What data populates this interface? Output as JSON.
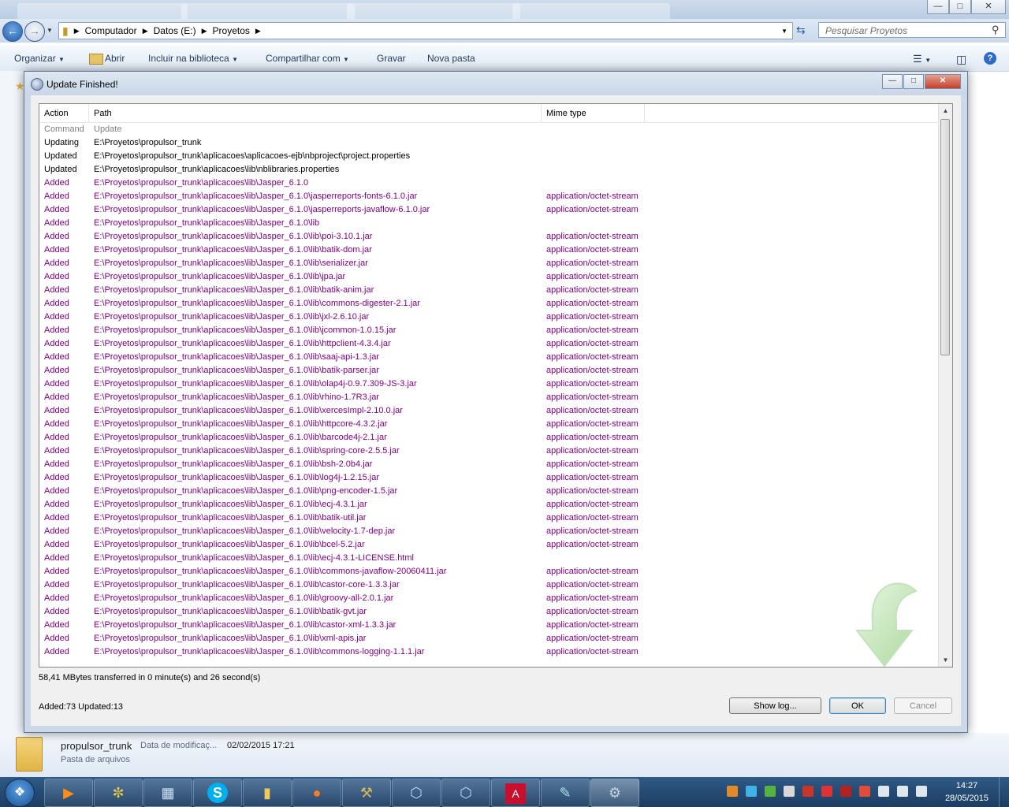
{
  "explorer": {
    "address": [
      "Computador",
      "Datos (E:)",
      "Proyetos"
    ],
    "search_placeholder": "Pesquisar Proyetos",
    "toolbar": {
      "organize": "Organizar",
      "open": "Abrir",
      "include_library": "Incluir na biblioteca",
      "share": "Compartilhar com",
      "burn": "Gravar",
      "new_folder": "Nova pasta"
    },
    "details": {
      "name": "propulsor_trunk",
      "modified_label": "Data de modificaç...",
      "modified_value": "02/02/2015 17:21",
      "type": "Pasta de arquivos"
    }
  },
  "dialog": {
    "title": "Update Finished!",
    "columns": {
      "action": "Action",
      "path": "Path",
      "mime": "Mime type"
    },
    "rows": [
      {
        "action": "Command",
        "path": "Update",
        "mime": "",
        "style": "muted"
      },
      {
        "action": "Updating",
        "path": "E:\\Proyetos\\propulsor_trunk",
        "mime": "",
        "style": "normal"
      },
      {
        "action": "Updated",
        "path": "E:\\Proyetos\\propulsor_trunk\\aplicacoes\\aplicacoes-ejb\\nbproject\\project.properties",
        "mime": "",
        "style": "normal"
      },
      {
        "action": "Updated",
        "path": "E:\\Proyetos\\propulsor_trunk\\aplicacoes\\lib\\nblibraries.properties",
        "mime": "",
        "style": "normal"
      },
      {
        "action": "Added",
        "path": "E:\\Proyetos\\propulsor_trunk\\aplicacoes\\lib\\Jasper_6.1.0",
        "mime": "",
        "style": "added"
      },
      {
        "action": "Added",
        "path": "E:\\Proyetos\\propulsor_trunk\\aplicacoes\\lib\\Jasper_6.1.0\\jasperreports-fonts-6.1.0.jar",
        "mime": "application/octet-stream",
        "style": "added"
      },
      {
        "action": "Added",
        "path": "E:\\Proyetos\\propulsor_trunk\\aplicacoes\\lib\\Jasper_6.1.0\\jasperreports-javaflow-6.1.0.jar",
        "mime": "application/octet-stream",
        "style": "added"
      },
      {
        "action": "Added",
        "path": "E:\\Proyetos\\propulsor_trunk\\aplicacoes\\lib\\Jasper_6.1.0\\lib",
        "mime": "",
        "style": "added"
      },
      {
        "action": "Added",
        "path": "E:\\Proyetos\\propulsor_trunk\\aplicacoes\\lib\\Jasper_6.1.0\\lib\\poi-3.10.1.jar",
        "mime": "application/octet-stream",
        "style": "added"
      },
      {
        "action": "Added",
        "path": "E:\\Proyetos\\propulsor_trunk\\aplicacoes\\lib\\Jasper_6.1.0\\lib\\batik-dom.jar",
        "mime": "application/octet-stream",
        "style": "added"
      },
      {
        "action": "Added",
        "path": "E:\\Proyetos\\propulsor_trunk\\aplicacoes\\lib\\Jasper_6.1.0\\lib\\serializer.jar",
        "mime": "application/octet-stream",
        "style": "added"
      },
      {
        "action": "Added",
        "path": "E:\\Proyetos\\propulsor_trunk\\aplicacoes\\lib\\Jasper_6.1.0\\lib\\jpa.jar",
        "mime": "application/octet-stream",
        "style": "added"
      },
      {
        "action": "Added",
        "path": "E:\\Proyetos\\propulsor_trunk\\aplicacoes\\lib\\Jasper_6.1.0\\lib\\batik-anim.jar",
        "mime": "application/octet-stream",
        "style": "added"
      },
      {
        "action": "Added",
        "path": "E:\\Proyetos\\propulsor_trunk\\aplicacoes\\lib\\Jasper_6.1.0\\lib\\commons-digester-2.1.jar",
        "mime": "application/octet-stream",
        "style": "added"
      },
      {
        "action": "Added",
        "path": "E:\\Proyetos\\propulsor_trunk\\aplicacoes\\lib\\Jasper_6.1.0\\lib\\jxl-2.6.10.jar",
        "mime": "application/octet-stream",
        "style": "added"
      },
      {
        "action": "Added",
        "path": "E:\\Proyetos\\propulsor_trunk\\aplicacoes\\lib\\Jasper_6.1.0\\lib\\jcommon-1.0.15.jar",
        "mime": "application/octet-stream",
        "style": "added"
      },
      {
        "action": "Added",
        "path": "E:\\Proyetos\\propulsor_trunk\\aplicacoes\\lib\\Jasper_6.1.0\\lib\\httpclient-4.3.4.jar",
        "mime": "application/octet-stream",
        "style": "added"
      },
      {
        "action": "Added",
        "path": "E:\\Proyetos\\propulsor_trunk\\aplicacoes\\lib\\Jasper_6.1.0\\lib\\saaj-api-1.3.jar",
        "mime": "application/octet-stream",
        "style": "added"
      },
      {
        "action": "Added",
        "path": "E:\\Proyetos\\propulsor_trunk\\aplicacoes\\lib\\Jasper_6.1.0\\lib\\batik-parser.jar",
        "mime": "application/octet-stream",
        "style": "added"
      },
      {
        "action": "Added",
        "path": "E:\\Proyetos\\propulsor_trunk\\aplicacoes\\lib\\Jasper_6.1.0\\lib\\olap4j-0.9.7.309-JS-3.jar",
        "mime": "application/octet-stream",
        "style": "added"
      },
      {
        "action": "Added",
        "path": "E:\\Proyetos\\propulsor_trunk\\aplicacoes\\lib\\Jasper_6.1.0\\lib\\rhino-1.7R3.jar",
        "mime": "application/octet-stream",
        "style": "added"
      },
      {
        "action": "Added",
        "path": "E:\\Proyetos\\propulsor_trunk\\aplicacoes\\lib\\Jasper_6.1.0\\lib\\xercesImpl-2.10.0.jar",
        "mime": "application/octet-stream",
        "style": "added"
      },
      {
        "action": "Added",
        "path": "E:\\Proyetos\\propulsor_trunk\\aplicacoes\\lib\\Jasper_6.1.0\\lib\\httpcore-4.3.2.jar",
        "mime": "application/octet-stream",
        "style": "added"
      },
      {
        "action": "Added",
        "path": "E:\\Proyetos\\propulsor_trunk\\aplicacoes\\lib\\Jasper_6.1.0\\lib\\barcode4j-2.1.jar",
        "mime": "application/octet-stream",
        "style": "added"
      },
      {
        "action": "Added",
        "path": "E:\\Proyetos\\propulsor_trunk\\aplicacoes\\lib\\Jasper_6.1.0\\lib\\spring-core-2.5.5.jar",
        "mime": "application/octet-stream",
        "style": "added"
      },
      {
        "action": "Added",
        "path": "E:\\Proyetos\\propulsor_trunk\\aplicacoes\\lib\\Jasper_6.1.0\\lib\\bsh-2.0b4.jar",
        "mime": "application/octet-stream",
        "style": "added"
      },
      {
        "action": "Added",
        "path": "E:\\Proyetos\\propulsor_trunk\\aplicacoes\\lib\\Jasper_6.1.0\\lib\\log4j-1.2.15.jar",
        "mime": "application/octet-stream",
        "style": "added"
      },
      {
        "action": "Added",
        "path": "E:\\Proyetos\\propulsor_trunk\\aplicacoes\\lib\\Jasper_6.1.0\\lib\\png-encoder-1.5.jar",
        "mime": "application/octet-stream",
        "style": "added"
      },
      {
        "action": "Added",
        "path": "E:\\Proyetos\\propulsor_trunk\\aplicacoes\\lib\\Jasper_6.1.0\\lib\\ecj-4.3.1.jar",
        "mime": "application/octet-stream",
        "style": "added"
      },
      {
        "action": "Added",
        "path": "E:\\Proyetos\\propulsor_trunk\\aplicacoes\\lib\\Jasper_6.1.0\\lib\\batik-util.jar",
        "mime": "application/octet-stream",
        "style": "added"
      },
      {
        "action": "Added",
        "path": "E:\\Proyetos\\propulsor_trunk\\aplicacoes\\lib\\Jasper_6.1.0\\lib\\velocity-1.7-dep.jar",
        "mime": "application/octet-stream",
        "style": "added"
      },
      {
        "action": "Added",
        "path": "E:\\Proyetos\\propulsor_trunk\\aplicacoes\\lib\\Jasper_6.1.0\\lib\\bcel-5.2.jar",
        "mime": "application/octet-stream",
        "style": "added"
      },
      {
        "action": "Added",
        "path": "E:\\Proyetos\\propulsor_trunk\\aplicacoes\\lib\\Jasper_6.1.0\\lib\\ecj-4.3.1-LICENSE.html",
        "mime": "",
        "style": "added"
      },
      {
        "action": "Added",
        "path": "E:\\Proyetos\\propulsor_trunk\\aplicacoes\\lib\\Jasper_6.1.0\\lib\\commons-javaflow-20060411.jar",
        "mime": "application/octet-stream",
        "style": "added"
      },
      {
        "action": "Added",
        "path": "E:\\Proyetos\\propulsor_trunk\\aplicacoes\\lib\\Jasper_6.1.0\\lib\\castor-core-1.3.3.jar",
        "mime": "application/octet-stream",
        "style": "added"
      },
      {
        "action": "Added",
        "path": "E:\\Proyetos\\propulsor_trunk\\aplicacoes\\lib\\Jasper_6.1.0\\lib\\groovy-all-2.0.1.jar",
        "mime": "application/octet-stream",
        "style": "added"
      },
      {
        "action": "Added",
        "path": "E:\\Proyetos\\propulsor_trunk\\aplicacoes\\lib\\Jasper_6.1.0\\lib\\batik-gvt.jar",
        "mime": "application/octet-stream",
        "style": "added"
      },
      {
        "action": "Added",
        "path": "E:\\Proyetos\\propulsor_trunk\\aplicacoes\\lib\\Jasper_6.1.0\\lib\\castor-xml-1.3.3.jar",
        "mime": "application/octet-stream",
        "style": "added"
      },
      {
        "action": "Added",
        "path": "E:\\Proyetos\\propulsor_trunk\\aplicacoes\\lib\\Jasper_6.1.0\\lib\\xml-apis.jar",
        "mime": "application/octet-stream",
        "style": "added"
      },
      {
        "action": "Added",
        "path": "E:\\Proyetos\\propulsor_trunk\\aplicacoes\\lib\\Jasper_6.1.0\\lib\\commons-logging-1.1.1.jar",
        "mime": "application/octet-stream",
        "style": "added"
      }
    ],
    "transfer_text": "58,41 MBytes transferred in 0 minute(s) and 26 second(s)",
    "counts_text": "Added:73 Updated:13",
    "buttons": {
      "show_log": "Show log...",
      "ok": "OK",
      "cancel": "Cancel"
    }
  },
  "taskbar": {
    "time": "14:27",
    "date": "28/05/2015"
  },
  "colors": {
    "added_row": "#800080",
    "muted_row": "#808080"
  }
}
